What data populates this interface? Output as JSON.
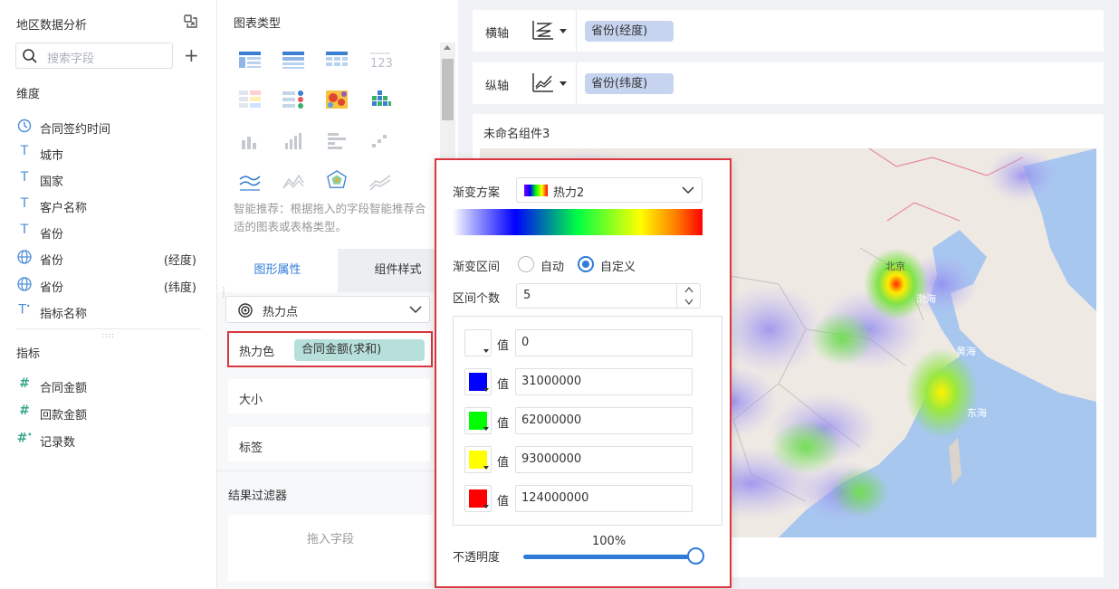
{
  "left": {
    "title": "地区数据分析",
    "search_placeholder": "搜索字段",
    "dimension_label": "维度",
    "dimensions": [
      {
        "name": "合同签约时间",
        "sub": ""
      },
      {
        "name": "城市",
        "sub": ""
      },
      {
        "name": "国家",
        "sub": ""
      },
      {
        "name": "客户名称",
        "sub": ""
      },
      {
        "name": "省份",
        "sub": ""
      },
      {
        "name": "省份",
        "sub": "(经度)"
      },
      {
        "name": "省份",
        "sub": "(纬度)"
      },
      {
        "name": "指标名称",
        "sub": ""
      }
    ],
    "measure_label": "指标",
    "measures": [
      {
        "name": "合同金额"
      },
      {
        "name": "回款金额"
      },
      {
        "name": "记录数"
      }
    ]
  },
  "middle": {
    "chart_type_title": "图表类型",
    "hint": "智能推荐：根据拖入的字段智能推荐合适的图表或表格类型。",
    "tabs": [
      "图形属性",
      "组件样式"
    ],
    "shape_select": "热力点",
    "props": {
      "color_label": "热力色",
      "color_field": "合同金额(求和)",
      "size_label": "大小",
      "label_label": "标签"
    },
    "filter": {
      "title": "结果过滤器",
      "placeholder": "拖入字段"
    }
  },
  "right": {
    "x_axis": {
      "label": "横轴",
      "field": "省份(经度)"
    },
    "y_axis": {
      "label": "纵轴",
      "field": "省份(纬度)"
    },
    "widget_title": "未命名组件3",
    "map_labels": [
      "北京",
      "渤海",
      "黄海",
      "东海"
    ]
  },
  "popup": {
    "gradient_label": "渐变方案",
    "gradient_name": "热力2",
    "range_label": "渐变区间",
    "range_options": [
      "自动",
      "自定义"
    ],
    "range_selected": "自定义",
    "count_label": "区间个数",
    "count_value": "5",
    "value_label": "值",
    "stops": [
      {
        "color": "#ffffff",
        "value": "0"
      },
      {
        "color": "#0000ff",
        "value": "31000000"
      },
      {
        "color": "#00ff00",
        "value": "62000000"
      },
      {
        "color": "#ffff00",
        "value": "93000000"
      },
      {
        "color": "#ff0000",
        "value": "124000000"
      }
    ],
    "opacity_label": "不透明度",
    "opacity_value": "100%"
  }
}
